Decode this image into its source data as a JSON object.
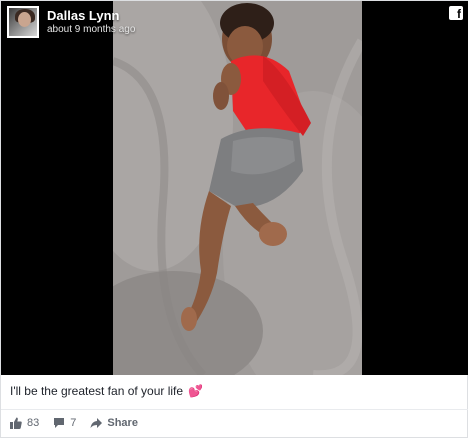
{
  "post": {
    "author_name": "Dallas Lynn",
    "timestamp": "about 9 months ago",
    "caption": "I'll be the greatest fan of your life",
    "caption_emoji": "💕",
    "brand_logo_letter": "f",
    "likes_count": "83",
    "comments_count": "7",
    "share_label": "Share"
  },
  "icons": {
    "brand": "facebook-icon",
    "like": "thumbs-up-icon",
    "comment": "comment-icon",
    "share": "share-arrow-icon"
  },
  "colors": {
    "video_background": "#000000",
    "caption_text": "#1d2129",
    "action_text": "#616770",
    "divider": "#e9ebee"
  }
}
